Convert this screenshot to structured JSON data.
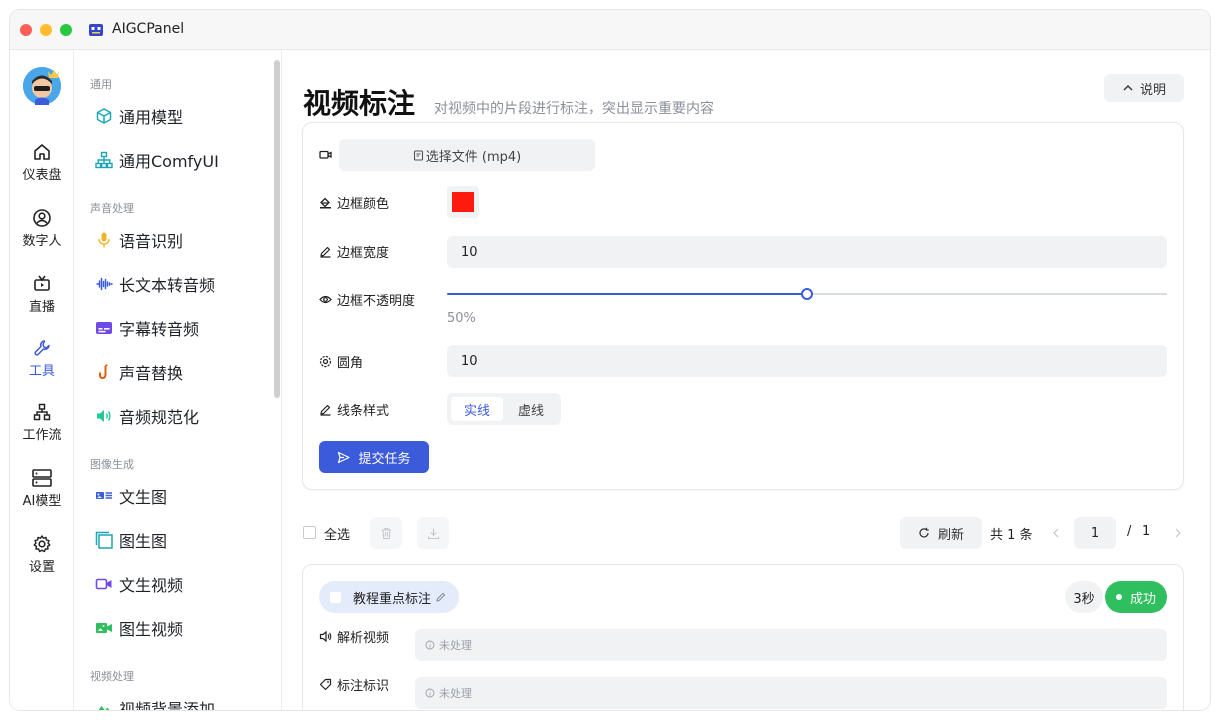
{
  "app": {
    "title": "AIGCPanel"
  },
  "rail": {
    "items": [
      {
        "label": "仪表盘",
        "icon": "home-icon"
      },
      {
        "label": "数字人",
        "icon": "user-circle-icon"
      },
      {
        "label": "直播",
        "icon": "tv-icon"
      },
      {
        "label": "工具",
        "icon": "wrench-icon"
      },
      {
        "label": "工作流",
        "icon": "workflow-icon"
      },
      {
        "label": "AI模型",
        "icon": "server-icon"
      },
      {
        "label": "设置",
        "icon": "gear-icon"
      }
    ],
    "active_index": 3
  },
  "sidebar": {
    "groups": [
      {
        "title": "通用",
        "items": [
          {
            "label": "通用模型",
            "icon": "cube-icon"
          },
          {
            "label": "通用ComfyUI",
            "icon": "hierarchy-icon"
          }
        ]
      },
      {
        "title": "声音处理",
        "items": [
          {
            "label": "语音识别",
            "icon": "microphone-icon"
          },
          {
            "label": "长文本转音频",
            "icon": "waveform-icon"
          },
          {
            "label": "字幕转音频",
            "icon": "subtitle-icon"
          },
          {
            "label": "声音替换",
            "icon": "saxophone-icon"
          },
          {
            "label": "音频规范化",
            "icon": "speaker-icon"
          }
        ]
      },
      {
        "title": "图像生成",
        "items": [
          {
            "label": "文生图",
            "icon": "text-image-icon"
          },
          {
            "label": "图生图",
            "icon": "image-copy-icon"
          },
          {
            "label": "文生视频",
            "icon": "video-camera-icon"
          },
          {
            "label": "图生视频",
            "icon": "video-image-icon"
          }
        ]
      },
      {
        "title": "视频处理",
        "items": [
          {
            "label": "视频背景添加",
            "icon": "mountain-icon"
          }
        ]
      }
    ]
  },
  "page": {
    "title": "视频标注",
    "subtitle": "对视频中的片段进行标注，突出显示重要内容",
    "help_label": "说明"
  },
  "form": {
    "file_button": "选择文件 (mp4)",
    "border_color_label": "边框颜色",
    "border_color_value": "#ff1a0f",
    "border_width_label": "边框宽度",
    "border_width_value": "10",
    "opacity_label": "边框不透明度",
    "opacity_value": "50%",
    "opacity_fraction": 0.5,
    "radius_label": "圆角",
    "radius_value": "10",
    "line_style_label": "线条样式",
    "line_style_options": [
      "实线",
      "虚线"
    ],
    "line_style_selected": "实线",
    "submit_label": "提交任务"
  },
  "list": {
    "select_all": "全选",
    "refresh": "刷新",
    "total": "共 1 条",
    "current_page": "1",
    "page_sep": "/",
    "total_pages": "1"
  },
  "task": {
    "name": "教程重点标注",
    "duration": "3秒",
    "status": "成功",
    "fields": [
      {
        "label": "解析视频",
        "value": "未处理",
        "icon": "speaker-icon"
      },
      {
        "label": "标注标识",
        "value": "未处理",
        "icon": "tag-icon"
      }
    ]
  },
  "colors": {
    "accent": "#3b5bdb",
    "success": "#2fbf5e",
    "tag_bg": "#e4ebfb"
  }
}
